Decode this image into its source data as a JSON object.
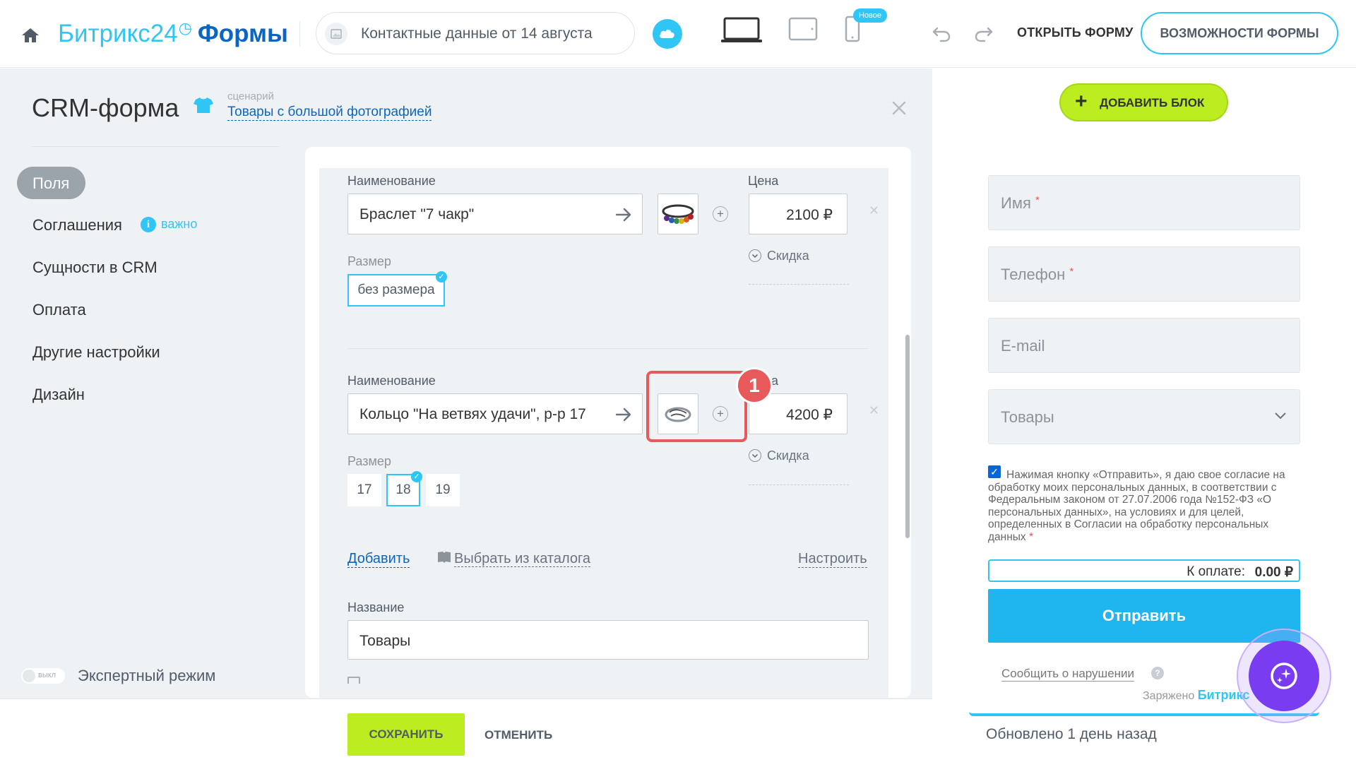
{
  "header": {
    "brand_name": "Битрикс24",
    "brand_clock": "◷",
    "brand_product": "Формы",
    "form_title": "Контактные данные от 14 августа",
    "new_badge": "Новое",
    "open_form": "ОТКРЫТЬ ФОРМУ",
    "features": "ВОЗМОЖНОСТИ ФОРМЫ"
  },
  "panel": {
    "title": "CRM-форма",
    "scenario_caption": "сценарий",
    "scenario_link": "Товары с большой фотографией",
    "nav": [
      {
        "label": "Поля"
      },
      {
        "label": "Соглашения"
      },
      {
        "label": "Сущности в CRM"
      },
      {
        "label": "Оплата"
      },
      {
        "label": "Другие настройки"
      },
      {
        "label": "Дизайн"
      }
    ],
    "info_glyph": "i",
    "important": "важно",
    "expert_toggle": "выкл",
    "expert_label": "Экспертный режим"
  },
  "products": {
    "name_label": "Наименование",
    "price_label": "Цена",
    "size_label": "Размер",
    "discount_label": "Скидка",
    "items": [
      {
        "name": "Браслет \"7 чакр\"",
        "price": "2100 ₽",
        "sizes": [
          "без размера"
        ]
      },
      {
        "name": "Кольцо \"На ветвях удачи\", р-р 17",
        "price": "4200 ₽",
        "sizes": [
          "17",
          "18",
          "19"
        ]
      }
    ],
    "partial_price_label": "а",
    "callout_number": "1",
    "add_link": "Добавить",
    "catalog_link": "Выбрать из каталога",
    "setup_link": "Настроить",
    "title_label": "Название",
    "title_value": "Товары"
  },
  "actions": {
    "save": "СОХРАНИТЬ",
    "cancel": "ОТМЕНИТЬ"
  },
  "preview": {
    "add_block": "ДОБАВИТЬ БЛОК",
    "fields": [
      {
        "placeholder": "Имя",
        "required": "*"
      },
      {
        "placeholder": "Телефон",
        "required": "*"
      },
      {
        "placeholder": "E-mail",
        "required": ""
      },
      {
        "placeholder": "Товары",
        "required": ""
      }
    ],
    "consent": "Нажимая кнопку «Отправить», я даю свое согласие на обработку моих персональных данных, в соответствии с Федеральным законом от 27.07.2006 года №152-ФЗ «О персональных данных», на условиях и для целей, определенных в Согласии на обработку персональных данных",
    "consent_required": "*",
    "to_pay_label": "К оплате:",
    "to_pay_amount": "0.00 ₽",
    "submit": "Отправить",
    "report": "Сообщить о нарушении",
    "help_glyph": "?",
    "powered_by": "Заряжено",
    "powered_brand": "Битрикс",
    "updated": "Обновлено 1 день назад"
  },
  "colors": {
    "accent": "#2fc6f6",
    "brand_dark": "#0b66c3",
    "save_green": "#bbed21",
    "highlight_red": "#e8595c",
    "submit_blue": "#1fb6f0"
  }
}
